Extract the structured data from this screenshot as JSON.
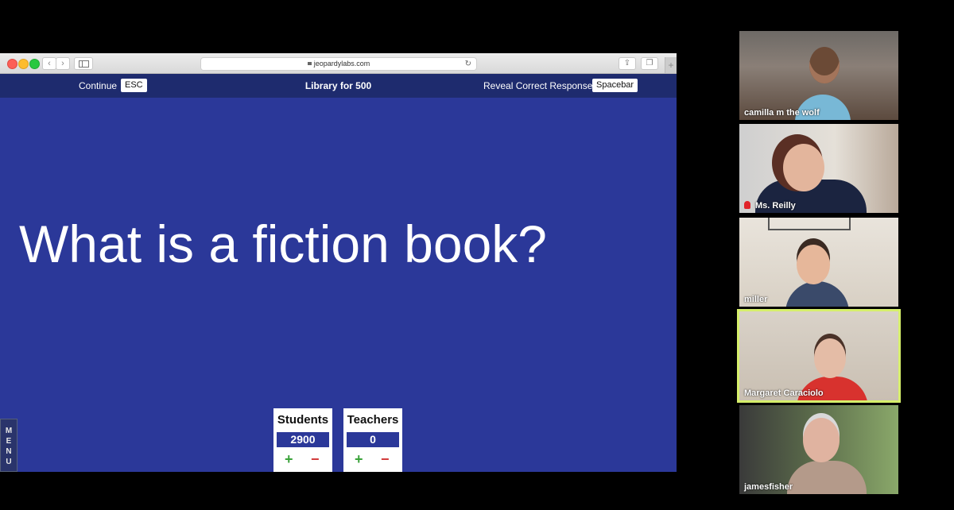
{
  "browser": {
    "url": "jeopardylabs.com"
  },
  "header": {
    "continue_label": "Continue",
    "continue_key": "ESC",
    "clue_title": "Library for 500",
    "reveal_label": "Reveal Correct Response",
    "reveal_key": "Spacebar"
  },
  "answer": "What is a fiction book?",
  "menu_label": "MENU",
  "scores": [
    {
      "team": "Students",
      "value": "2900"
    },
    {
      "team": "Teachers",
      "value": "0"
    }
  ],
  "score_controls": {
    "plus": "+",
    "minus": "−"
  },
  "participants": [
    {
      "name": "camilla m the wolf",
      "muted": false
    },
    {
      "name": "Ms. Reilly",
      "muted": true
    },
    {
      "name": "miller",
      "muted": false
    },
    {
      "name": "Margaret Caraciolo",
      "muted": false,
      "active_speaker": true
    },
    {
      "name": "jamesfisher",
      "muted": false
    }
  ],
  "colors": {
    "page_blue": "#2b3899",
    "header_navy": "#1e2b6e",
    "active_speaker_border": "#d6ef6b",
    "plus_green": "#3aa33a",
    "minus_red": "#d23a3a"
  }
}
